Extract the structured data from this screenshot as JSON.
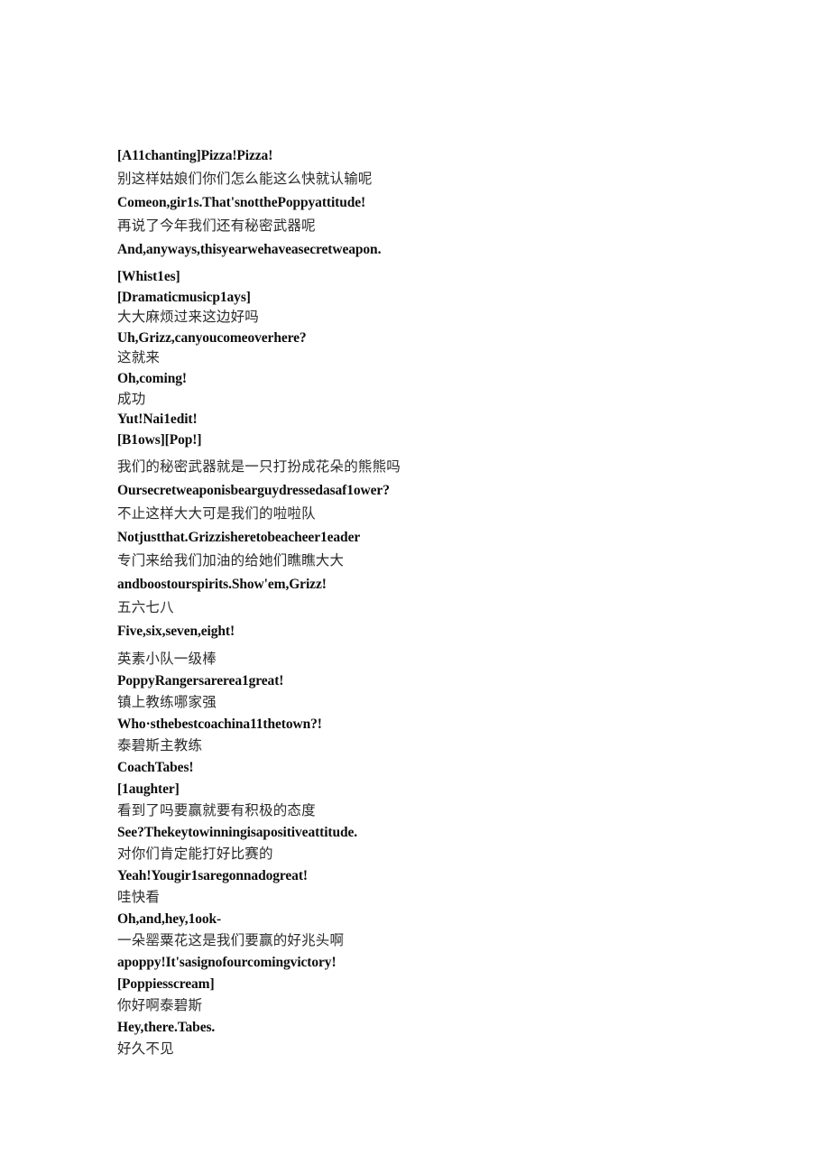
{
  "document": {
    "type": "bilingual-subtitle-transcript",
    "page_background": "#ffffff",
    "text_color_source": "#2b2b2b",
    "text_color_translation": "#0d0d0d",
    "blocks": [
      {
        "id": "block-1",
        "spacing": "normal",
        "lines": [
          {
            "lang": "en",
            "text": "[A11chanting]Pizza!Pizza!"
          },
          {
            "lang": "zh",
            "text": "别这样姑娘们你们怎么能这么快就认输呢"
          },
          {
            "lang": "en",
            "text": "Comeon,gir1s.That'snotthePoppyattitude!"
          },
          {
            "lang": "zh",
            "text": "再说了今年我们还有秘密武器呢"
          },
          {
            "lang": "en",
            "text": "And,anyways,thisyearwehaveasecretweapon."
          }
        ]
      },
      {
        "id": "block-2",
        "spacing": "tight",
        "lines": [
          {
            "lang": "en",
            "text": "[Whist1es]"
          },
          {
            "lang": "en",
            "text": "[Dramaticmusicp1ays]"
          },
          {
            "lang": "zh",
            "text": "大大麻烦过来这边好吗"
          },
          {
            "lang": "en",
            "text": "Uh,Grizz,canyoucomeoverhere?"
          },
          {
            "lang": "zh",
            "text": "这就来"
          },
          {
            "lang": "en",
            "text": "Oh,coming!"
          },
          {
            "lang": "zh",
            "text": "成功"
          },
          {
            "lang": "en",
            "text": "Yut!Nai1edit!"
          },
          {
            "lang": "en",
            "text": "[B1ows][Pop!]"
          }
        ]
      },
      {
        "id": "block-3",
        "spacing": "normal",
        "lines": [
          {
            "lang": "zh",
            "text": "我们的秘密武器就是一只打扮成花朵的熊熊吗"
          },
          {
            "lang": "en",
            "text": "Oursecretweaponisbearguydressedasaf1ower?"
          },
          {
            "lang": "zh",
            "text": "不止这样大大可是我们的啦啦队"
          },
          {
            "lang": "en",
            "text": "Notjustthat.Grizzisheretobeacheer1eader"
          },
          {
            "lang": "zh",
            "text": "专门来给我们加油的给她们瞧瞧大大"
          },
          {
            "lang": "en",
            "text": "andboostourspirits.Show'em,Grizz!"
          },
          {
            "lang": "zh",
            "text": "五六七八"
          },
          {
            "lang": "en",
            "text": "Five,six,seven,eight!"
          }
        ]
      },
      {
        "id": "block-4",
        "spacing": "medium",
        "lines": [
          {
            "lang": "zh",
            "text": "英素小队一级棒"
          },
          {
            "lang": "en",
            "text": "PoppyRangersarerea1great!"
          },
          {
            "lang": "zh",
            "text": "镇上教练哪家强"
          },
          {
            "lang": "en",
            "text": "Who·sthebestcoachina11thetown?!"
          },
          {
            "lang": "zh",
            "text": "泰碧斯主教练"
          },
          {
            "lang": "en",
            "text": "CoachTabes!"
          },
          {
            "lang": "en",
            "text": "[1aughter]"
          },
          {
            "lang": "zh",
            "text": "看到了吗要赢就要有积极的态度"
          },
          {
            "lang": "en",
            "text": "See?Thekeytowinningisapositiveattitude."
          },
          {
            "lang": "zh",
            "text": "对你们肯定能打好比赛的"
          },
          {
            "lang": "en",
            "text": "Yeah!Yougir1saregonnadogreat!"
          },
          {
            "lang": "zh",
            "text": "哇快看"
          },
          {
            "lang": "en",
            "text": "Oh,and,hey,1ook-"
          },
          {
            "lang": "zh",
            "text": "一朵罂粟花这是我们要赢的好兆头啊"
          },
          {
            "lang": "en",
            "text": "apoppy!It'sasignofourcomingvictory!"
          },
          {
            "lang": "en",
            "text": "[Poppiesscream]"
          },
          {
            "lang": "zh",
            "text": "你好啊泰碧斯"
          },
          {
            "lang": "en",
            "text": "Hey,there.Tabes."
          },
          {
            "lang": "zh",
            "text": "好久不见"
          }
        ]
      }
    ]
  }
}
